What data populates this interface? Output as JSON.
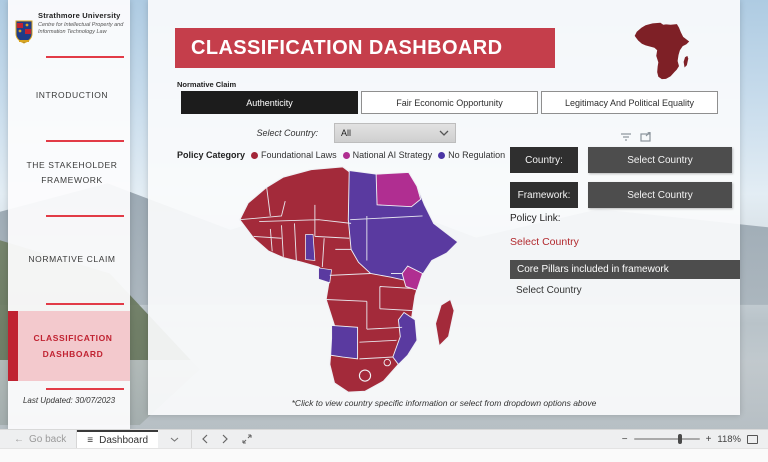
{
  "university": {
    "name": "Strathmore University",
    "subtitle": "Centre for Intellectual Property and Information Technology Law"
  },
  "sidebar": {
    "items": [
      {
        "label": "INTRODUCTION",
        "active": false
      },
      {
        "label": "THE STAKEHOLDER FRAMEWORK",
        "active": false
      },
      {
        "label": "NORMATIVE CLAIM",
        "active": false
      },
      {
        "label": "CLASSIFICATION DASHBOARD",
        "active": true
      }
    ],
    "last_updated_label": "Last Updated:",
    "last_updated_value": "30/07/2023"
  },
  "header": {
    "title": "CLASSIFICATION DASHBOARD"
  },
  "normative_claim": {
    "label": "Normative Claim",
    "tabs": [
      {
        "label": "Authenticity",
        "active": true
      },
      {
        "label": "Fair Economic Opportunity",
        "active": false
      },
      {
        "label": "Legitimacy And Political Equality",
        "active": false
      }
    ]
  },
  "country_filter": {
    "label": "Select Country:",
    "value": "All"
  },
  "map": {
    "legend_title": "Policy Category",
    "legend": [
      {
        "label": "Foundational Laws",
        "color": "#a32638"
      },
      {
        "label": "National AI Strategy",
        "color": "#b02e91"
      },
      {
        "label": "No Regulation",
        "color": "#4b35a5"
      }
    ],
    "colors": {
      "red": "#a32a3a",
      "mag": "#b02e91",
      "pur": "#5a3aa0"
    },
    "depicted_categories": {
      "National AI Strategy": [
        "Egypt",
        "Kenya"
      ],
      "No Regulation": [
        "Libya",
        "Chad",
        "Sudan",
        "South Sudan",
        "Eritrea",
        "Ethiopia",
        "Somalia",
        "Central African Republic",
        "Benin",
        "Gabon",
        "Namibia",
        "Mozambique"
      ],
      "Foundational Laws": [
        "Morocco",
        "Algeria",
        "Tunisia",
        "Mauritania",
        "Mali",
        "Niger",
        "Senegal",
        "Guinea",
        "Ghana",
        "Nigeria",
        "Cameroon",
        "DR Congo",
        "Uganda",
        "Tanzania",
        "Angola",
        "Zambia",
        "Zimbabwe",
        "Botswana",
        "South Africa",
        "Madagascar"
      ]
    }
  },
  "right_panel": {
    "rows": [
      {
        "label": "Country:",
        "value": "Select Country"
      },
      {
        "label": "Framework:",
        "value": "Select Country"
      }
    ],
    "policy_link_label": "Policy Link:",
    "policy_link_value": "Select Country",
    "core_pillars_header": "Core Pillars included in framework",
    "core_pillars_value": "Select Country"
  },
  "footer_note": "*Click to view country specific information or select from dropdown options above",
  "app_bar": {
    "go_back": "Go back",
    "tab": "Dashboard",
    "zoom": "118%"
  },
  "icons": {
    "back_arrow": "←",
    "menu": "≡",
    "minus": "−",
    "plus": "+"
  }
}
